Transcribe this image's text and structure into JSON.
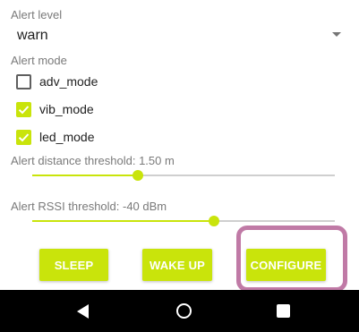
{
  "alert_level": {
    "label": "Alert level",
    "value": "warn"
  },
  "alert_mode": {
    "label": "Alert mode",
    "options": [
      {
        "label": "adv_mode",
        "checked": false
      },
      {
        "label": "vib_mode",
        "checked": true
      },
      {
        "label": "led_mode",
        "checked": true
      }
    ]
  },
  "distance_threshold": {
    "label": "Alert distance threshold: 1.50 m",
    "slider_fraction": 0.35
  },
  "rssi_threshold": {
    "label": "Alert RSSI threshold: -40 dBm",
    "slider_fraction": 0.6
  },
  "buttons": {
    "sleep": "SLEEP",
    "wake_up": "WAKE UP",
    "configure": "CONFIGURE"
  },
  "colors": {
    "accent": "#c9e40b",
    "highlight": "#c07aa6",
    "navbar": "#000000"
  },
  "icons": {
    "dropdown": "chevron-down-icon",
    "checkbox_checked": "check-icon",
    "nav_back": "back-triangle-icon",
    "nav_home": "home-circle-icon",
    "nav_recent": "recent-square-icon"
  }
}
